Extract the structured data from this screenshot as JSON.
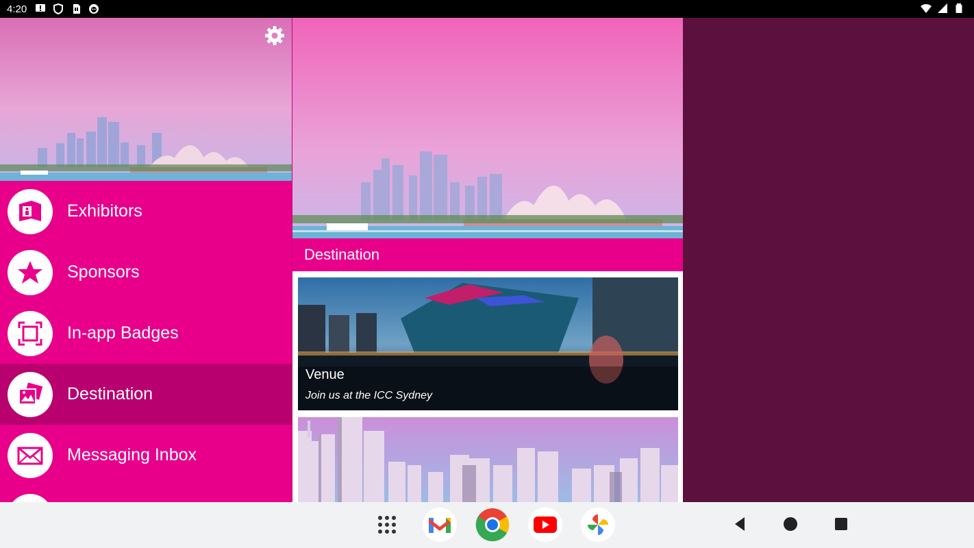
{
  "status_bar": {
    "time": "4:20",
    "left_icons": [
      "message-icon",
      "shield-icon",
      "sim-card-icon",
      "face-icon"
    ],
    "right_icons": [
      "wifi-icon",
      "signal-icon",
      "battery-icon"
    ]
  },
  "drawer": {
    "settings_icon": "gear-icon",
    "items": [
      {
        "label": "Exhibitors",
        "icon": "exhibitor-booth-icon"
      },
      {
        "label": "Sponsors",
        "icon": "star-icon"
      },
      {
        "label": "In-app Badges",
        "icon": "scan-frame-icon"
      },
      {
        "label": "Destination",
        "icon": "photos-icon",
        "selected": true
      },
      {
        "label": "Messaging Inbox",
        "icon": "envelope-icon"
      }
    ]
  },
  "content": {
    "title": "Destination",
    "cards": [
      {
        "title": "Venue",
        "subtitle": "Join us at the ICC Sydney"
      },
      {
        "title": "",
        "subtitle": ""
      }
    ]
  },
  "nav_bar": {
    "apps": [
      "app-grid-icon",
      "gmail-icon",
      "chrome-icon",
      "youtube-icon",
      "photos-icon"
    ],
    "buttons": [
      "back-icon",
      "home-icon",
      "recents-icon"
    ]
  },
  "colors": {
    "primary": "#e8008a",
    "selected": "#b8006e",
    "background": "#5c103d"
  }
}
